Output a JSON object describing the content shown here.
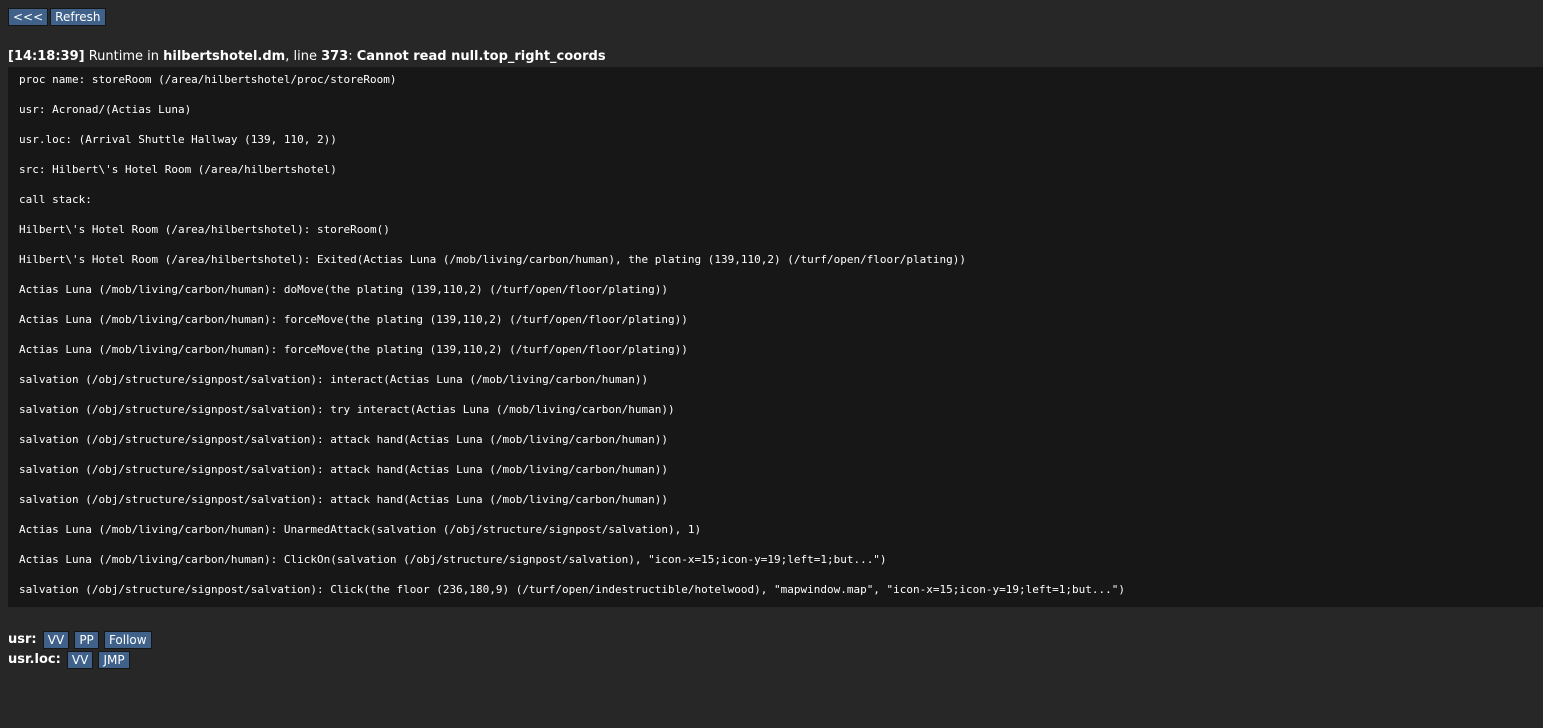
{
  "toolbar": {
    "back_label": "<<<",
    "refresh_label": "Refresh"
  },
  "error": {
    "timestamp": "[14:18:39]",
    "runtime_prefix": " Runtime in ",
    "file": "hilbertshotel.dm",
    "line_prefix": ", line ",
    "line": "373",
    "separator": ": ",
    "message": "Cannot read null.top_right_coords"
  },
  "log_lines": [
    "proc name: storeRoom (/area/hilbertshotel/proc/storeRoom)",
    "usr: Acronad/(Actias Luna)",
    "usr.loc: (Arrival Shuttle Hallway (139, 110, 2))",
    "src: Hilbert\\'s Hotel Room (/area/hilbertshotel)",
    "call stack:",
    "Hilbert\\'s Hotel Room (/area/hilbertshotel): storeRoom()",
    "Hilbert\\'s Hotel Room (/area/hilbertshotel): Exited(Actias Luna (/mob/living/carbon/human), the plating (139,110,2) (/turf/open/floor/plating))",
    "Actias Luna (/mob/living/carbon/human): doMove(the plating (139,110,2) (/turf/open/floor/plating))",
    "Actias Luna (/mob/living/carbon/human): forceMove(the plating (139,110,2) (/turf/open/floor/plating))",
    "Actias Luna (/mob/living/carbon/human): forceMove(the plating (139,110,2) (/turf/open/floor/plating))",
    "salvation (/obj/structure/signpost/salvation): interact(Actias Luna (/mob/living/carbon/human))",
    "salvation (/obj/structure/signpost/salvation): try interact(Actias Luna (/mob/living/carbon/human))",
    "salvation (/obj/structure/signpost/salvation): attack hand(Actias Luna (/mob/living/carbon/human))",
    "salvation (/obj/structure/signpost/salvation): attack hand(Actias Luna (/mob/living/carbon/human))",
    "salvation (/obj/structure/signpost/salvation): attack hand(Actias Luna (/mob/living/carbon/human))",
    "Actias Luna (/mob/living/carbon/human): UnarmedAttack(salvation (/obj/structure/signpost/salvation), 1)",
    "Actias Luna (/mob/living/carbon/human): ClickOn(salvation (/obj/structure/signpost/salvation), \"icon-x=15;icon-y=19;left=1;but...\")",
    "salvation (/obj/structure/signpost/salvation): Click(the floor (236,180,9) (/turf/open/indestructible/hotelwood), \"mapwindow.map\", \"icon-x=15;icon-y=19;left=1;but...\")"
  ],
  "refs": {
    "usr": {
      "label": "usr:",
      "vv": "VV",
      "pp": "PP",
      "follow": "Follow"
    },
    "usr_loc": {
      "label": "usr.loc:",
      "vv": "VV",
      "jmp": "JMP"
    }
  },
  "colors": {
    "background": "#272727",
    "log_background": "#171717",
    "button": "#40628a",
    "text": "#ffffff"
  }
}
